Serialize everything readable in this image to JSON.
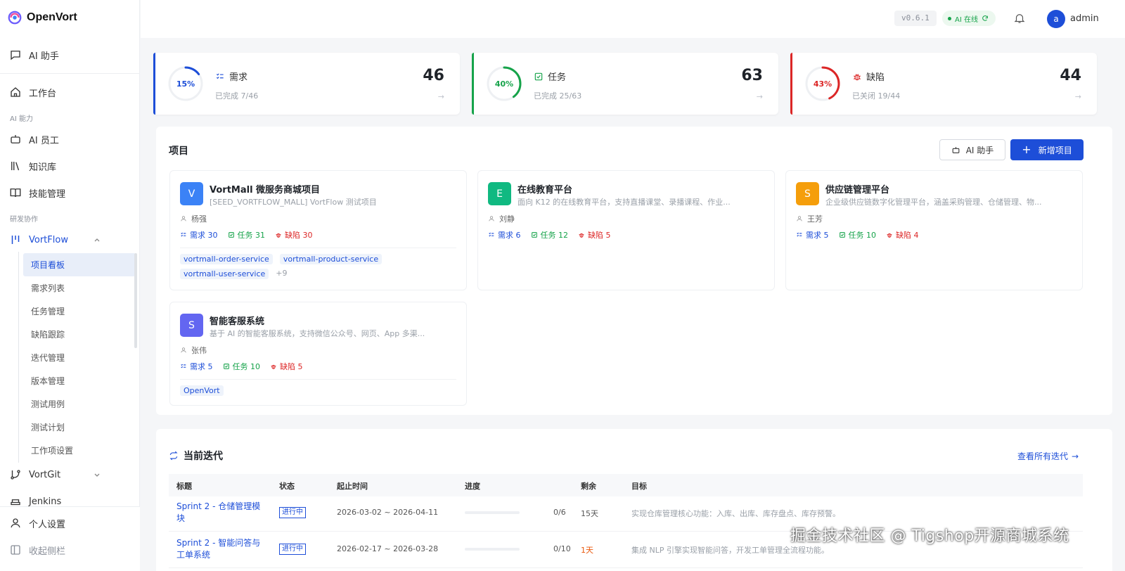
{
  "app": {
    "name": "OpenVort",
    "version": "v0.6.1",
    "ai_status": "AI 在线",
    "user_initial": "a",
    "username": "admin"
  },
  "sidebar": {
    "ai_assistant": "AI 助手",
    "workbench": "工作台",
    "ai_section": "AI 能力",
    "ai_employee": "AI 员工",
    "knowledge": "知识库",
    "skills": "技能管理",
    "dev_section": "研发协作",
    "vortflow": "VortFlow",
    "sub_items": [
      "项目看板",
      "需求列表",
      "任务管理",
      "缺陷跟踪",
      "迭代管理",
      "版本管理",
      "测试用例",
      "测试计划",
      "工作项设置"
    ],
    "vortgit": "VortGit",
    "jenkins": "Jenkins",
    "settings": "个人设置",
    "collapse": "收起侧栏"
  },
  "stats": [
    {
      "pct_label": "15%",
      "pct": 0.15,
      "title": "需求",
      "sub": "已完成 7/46",
      "count": "46",
      "color": "#1d4ed8"
    },
    {
      "pct_label": "40%",
      "pct": 0.4,
      "title": "任务",
      "sub": "已完成 25/63",
      "count": "63",
      "color": "#16a34a"
    },
    {
      "pct_label": "43%",
      "pct": 0.43,
      "title": "缺陷",
      "sub": "已关闭 19/44",
      "count": "44",
      "color": "#dc2626"
    }
  ],
  "projects_panel": {
    "title": "项目",
    "ai_button": "AI 助手",
    "new_button": "新增项目"
  },
  "projects": [
    {
      "initial": "V",
      "color": "#3b82f6",
      "name": "VortMall 微服务商城项目",
      "desc": "[SEED_VORTFLOW_MALL] VortFlow 测试项目",
      "owner": "杨强",
      "req": "需求 30",
      "task": "任务 31",
      "bug": "缺陷 30",
      "tags": [
        "vortmall-order-service",
        "vortmall-product-service",
        "vortmall-user-service"
      ],
      "more": "+9"
    },
    {
      "initial": "E",
      "color": "#10b981",
      "name": "在线教育平台",
      "desc": "面向 K12 的在线教育平台，支持直播课堂、录播课程、作业...",
      "owner": "刘静",
      "req": "需求 6",
      "task": "任务 12",
      "bug": "缺陷 5",
      "tags": [],
      "more": ""
    },
    {
      "initial": "S",
      "color": "#f59e0b",
      "name": "供应链管理平台",
      "desc": "企业级供应链数字化管理平台，涵盖采购管理、仓储管理、物...",
      "owner": "王芳",
      "req": "需求 5",
      "task": "任务 10",
      "bug": "缺陷 4",
      "tags": [],
      "more": ""
    },
    {
      "initial": "S",
      "color": "#6366f1",
      "name": "智能客服系统",
      "desc": "基于 AI 的智能客服系统，支持微信公众号、网页、App 多渠...",
      "owner": "张伟",
      "req": "需求 5",
      "task": "任务 10",
      "bug": "缺陷 5",
      "tags": [
        "OpenVort"
      ],
      "more": ""
    }
  ],
  "iteration": {
    "title": "当前迭代",
    "view_all": "查看所有迭代",
    "headers": [
      "标题",
      "状态",
      "起止时间",
      "进度",
      "剩余",
      "目标"
    ],
    "rows": [
      {
        "title": "Sprint 2 - 仓储管理模块",
        "status": "进行中",
        "dates": "2026-03-02 ~ 2026-04-11",
        "progress": "0/6",
        "remain": "15天",
        "remain_color": "#555",
        "goal": "实现仓库管理核心功能：入库、出库、库存盘点、库存预警。"
      },
      {
        "title": "Sprint 2 - 智能问答与工单系统",
        "status": "进行中",
        "dates": "2026-02-17 ~ 2026-03-28",
        "progress": "0/10",
        "remain": "1天",
        "remain_color": "#ea580c",
        "goal": "集成 NLP 引擎实现智能问答，开发工单管理全流程功能。"
      }
    ]
  },
  "watermark": "掘金技术社区 @ Tigshop开源商城系统"
}
